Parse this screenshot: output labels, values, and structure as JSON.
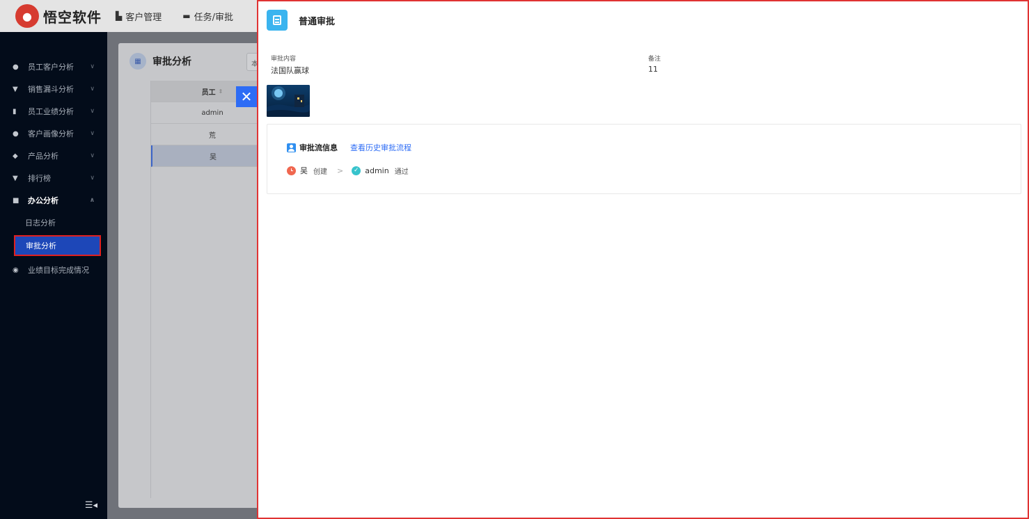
{
  "app": {
    "logo_text": "悟空软件"
  },
  "topnav": [
    {
      "label": "客户管理",
      "icon": "building-icon"
    },
    {
      "label": "任务/审批",
      "icon": "briefcase-icon"
    }
  ],
  "sidebar": {
    "items": [
      {
        "label": "员工客户分析",
        "icon": "user-icon"
      },
      {
        "label": "销售漏斗分析",
        "icon": "funnel-icon"
      },
      {
        "label": "员工业绩分析",
        "icon": "bar-chart-icon"
      },
      {
        "label": "客户画像分析",
        "icon": "users-icon"
      },
      {
        "label": "产品分析",
        "icon": "box-icon"
      },
      {
        "label": "排行榜",
        "icon": "trophy-icon"
      },
      {
        "label": "办公分析",
        "icon": "briefcase-icon"
      },
      {
        "label": "业绩目标完成情况",
        "icon": "target-icon"
      }
    ],
    "sub_items": [
      "日志分析",
      "审批分析"
    ]
  },
  "main": {
    "title": "审批分析",
    "select_value": "本",
    "table": {
      "header": "员工",
      "rows": [
        "admin",
        "荒",
        "吴"
      ]
    }
  },
  "drawer": {
    "title": "普通审批",
    "fields": {
      "content_label": "审批内容",
      "content_value": "法国队赢球",
      "remark_label": "备注",
      "remark_value": "11"
    },
    "flow": {
      "title": "审批流信息",
      "history_link": "查看历史审批流程",
      "steps": [
        {
          "name": "吴",
          "action": "创建"
        },
        {
          "name": "admin",
          "action": "通过"
        }
      ]
    }
  },
  "colors": {
    "accent": "#2d6cf5",
    "sidebar_bg": "#030c1a",
    "highlight_border": "#e03333",
    "doc_icon": "#3ab4ef"
  }
}
